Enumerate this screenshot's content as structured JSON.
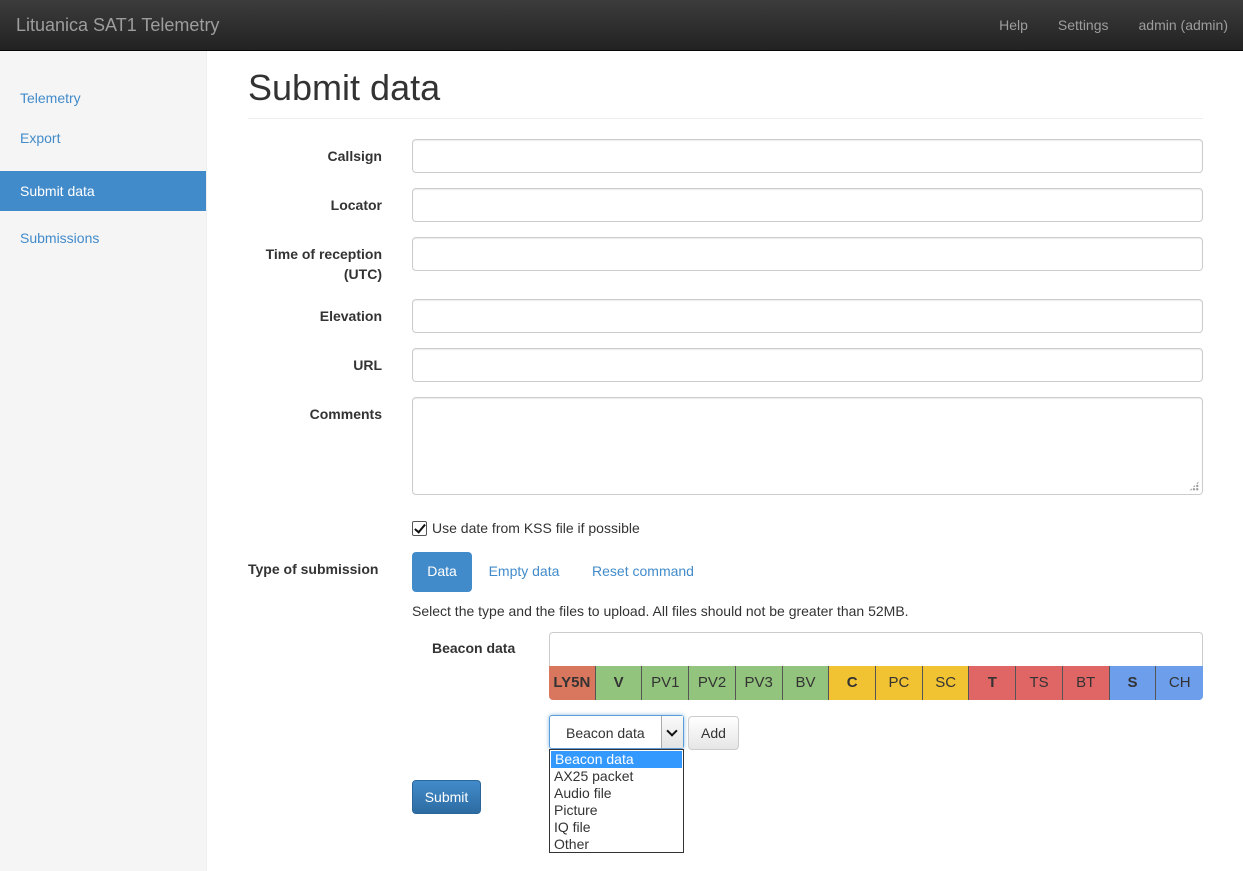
{
  "app": {
    "title": "Lituanica SAT1 Telemetry"
  },
  "nav": {
    "help": "Help",
    "settings": "Settings",
    "user": "admin (admin)"
  },
  "sidebar": {
    "items": [
      {
        "label": "Telemetry"
      },
      {
        "label": "Export"
      },
      {
        "label": "Submit data",
        "active": true
      },
      {
        "label": "Submissions"
      }
    ]
  },
  "page": {
    "title": "Submit data"
  },
  "form": {
    "callsign": {
      "label": "Callsign",
      "value": ""
    },
    "locator": {
      "label": "Locator",
      "value": ""
    },
    "time": {
      "label_line1": "Time of reception",
      "label_line2": "(UTC)",
      "value": ""
    },
    "elevation": {
      "label": "Elevation",
      "value": ""
    },
    "url": {
      "label": "URL",
      "value": ""
    },
    "comments": {
      "label": "Comments",
      "value": ""
    },
    "use_kss_date": {
      "label": "Use date from KSS file if possible",
      "checked": true
    },
    "type": {
      "label": "Type of submission",
      "pills": [
        {
          "label": "Data",
          "active": true
        },
        {
          "label": "Empty data"
        },
        {
          "label": "Reset command"
        }
      ]
    },
    "hint": "Select the type and the files to upload. All files should not be greater than 52MB.",
    "beacon": {
      "label": "Beacon data",
      "value": "",
      "cells": [
        {
          "text": "LY5N",
          "color": "#d9775e",
          "bold": true
        },
        {
          "text": "V",
          "color": "#93c47d",
          "bold": true
        },
        {
          "text": "PV1",
          "color": "#93c47d"
        },
        {
          "text": "PV2",
          "color": "#93c47d"
        },
        {
          "text": "PV3",
          "color": "#93c47d"
        },
        {
          "text": "BV",
          "color": "#93c47d"
        },
        {
          "text": "C",
          "color": "#f1c232",
          "bold": true
        },
        {
          "text": "PC",
          "color": "#f1c232"
        },
        {
          "text": "SC",
          "color": "#f1c232"
        },
        {
          "text": "T",
          "color": "#e06666",
          "bold": true
        },
        {
          "text": "TS",
          "color": "#e06666"
        },
        {
          "text": "BT",
          "color": "#e06666"
        },
        {
          "text": "S",
          "color": "#6d9eeb",
          "bold": true
        },
        {
          "text": "CH",
          "color": "#6d9eeb"
        }
      ]
    },
    "file_type": {
      "selected": "Beacon data",
      "options": [
        "Beacon data",
        "AX25 packet",
        "Audio file",
        "Picture",
        "IQ file",
        "Other"
      ]
    },
    "add_label": "Add",
    "submit_label": "Submit"
  }
}
